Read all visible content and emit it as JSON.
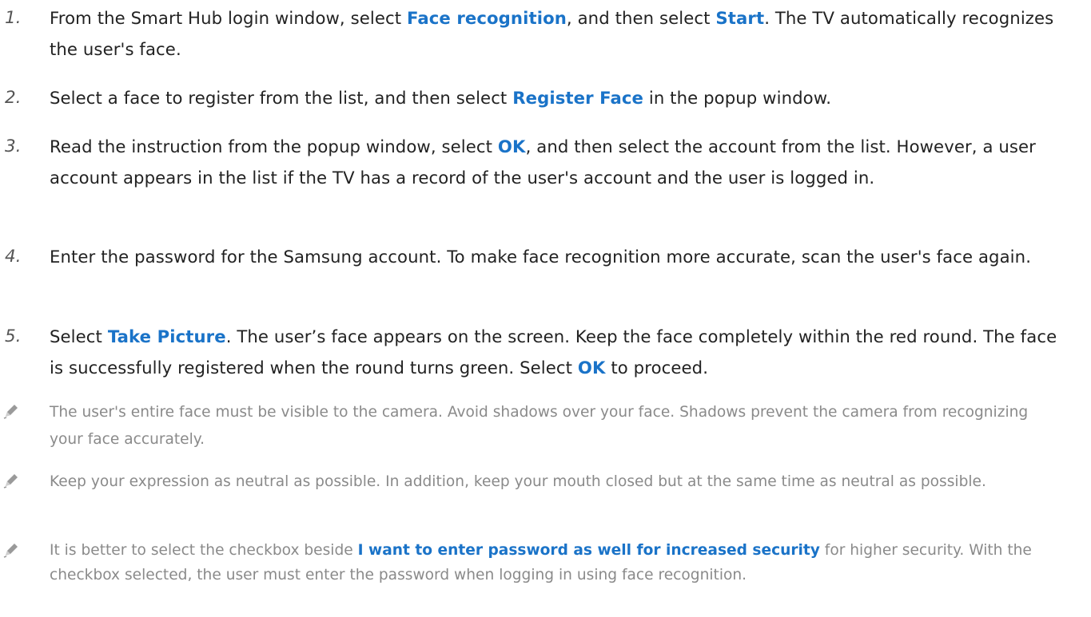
{
  "steps": [
    {
      "number": "1.",
      "parts": [
        {
          "t": "From the Smart Hub login window, select "
        },
        {
          "t": "Face recognition",
          "hl": true
        },
        {
          "t": ", and then select "
        },
        {
          "t": "Start",
          "hl": true
        },
        {
          "t": ". The TV automatically recognizes the user's face."
        }
      ]
    },
    {
      "number": "2.",
      "parts": [
        {
          "t": "Select a face to register from the list, and then select "
        },
        {
          "t": "Register Face",
          "hl": true
        },
        {
          "t": " in the popup window."
        }
      ]
    },
    {
      "number": "3.",
      "parts": [
        {
          "t": "Read the instruction from the popup window, select "
        },
        {
          "t": "OK",
          "hl": true
        },
        {
          "t": ", and then select the account from the list. However, a user account appears in the list if the TV has a record of the user's account and the user is logged in."
        }
      ]
    },
    {
      "number": "4.",
      "parts": [
        {
          "t": "Enter the password for the Samsung account. To make face recognition more accurate, scan the user's face again."
        }
      ]
    },
    {
      "number": "5.",
      "parts": [
        {
          "t": "Select "
        },
        {
          "t": "Take Picture",
          "hl": true
        },
        {
          "t": ". The user’s face appears on the screen. Keep the face completely within the red round. The face is successfully registered when the round turns green. Select "
        },
        {
          "t": "OK",
          "hl": true
        },
        {
          "t": " to proceed."
        }
      ]
    }
  ],
  "notes": [
    {
      "icon": "pencil-icon",
      "parts": [
        {
          "t": "The user's entire face must be visible to the camera. Avoid shadows over your face. Shadows prevent the camera from recognizing your face accurately."
        }
      ]
    },
    {
      "icon": "pencil-icon",
      "parts": [
        {
          "t": "Keep your expression as neutral as possible. In addition, keep your mouth closed but at the same time as neutral as possible."
        }
      ]
    },
    {
      "icon": "pencil-icon",
      "parts": [
        {
          "t": "It is better to select the checkbox beside "
        },
        {
          "t": "I want to enter password as well for increased security",
          "hl": true
        },
        {
          "t": " for higher security. With the checkbox selected, the user must enter the password when logging in using face recognition."
        }
      ]
    }
  ],
  "colors": {
    "highlight": "#1a73c8",
    "step_text": "#222222",
    "note_text": "#8a8a8a"
  }
}
